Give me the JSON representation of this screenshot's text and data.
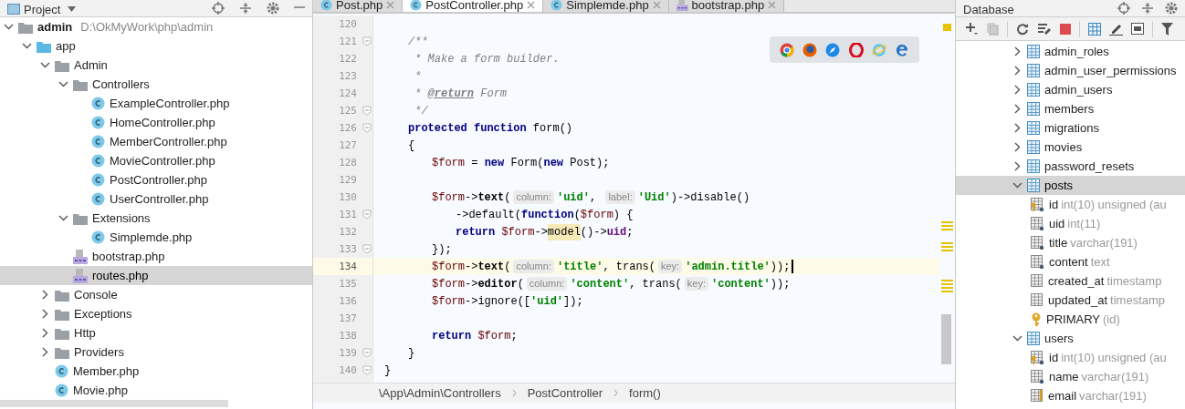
{
  "project_panel": {
    "title": "Project",
    "tree": [
      {
        "name": "admin",
        "path": "D:\\OkMyWork\\php\\admin",
        "kind": "folder",
        "expanded": true,
        "selected": false,
        "children": [
          {
            "name": "app",
            "kind": "source_folder",
            "expanded": true,
            "selected": false,
            "children": [
              {
                "name": "Admin",
                "kind": "folder",
                "expanded": true,
                "selected": false,
                "children": [
                  {
                    "name": "Controllers",
                    "kind": "folder",
                    "expanded": true,
                    "selected": false,
                    "children": [
                      {
                        "name": "ExampleController.php",
                        "kind": "class",
                        "selected": false
                      },
                      {
                        "name": "HomeController.php",
                        "kind": "class",
                        "selected": false
                      },
                      {
                        "name": "MemberController.php",
                        "kind": "class",
                        "selected": false
                      },
                      {
                        "name": "MovieController.php",
                        "kind": "class",
                        "selected": false
                      },
                      {
                        "name": "PostController.php",
                        "kind": "class",
                        "selected": false
                      },
                      {
                        "name": "UserController.php",
                        "kind": "class",
                        "selected": false
                      }
                    ]
                  },
                  {
                    "name": "Extensions",
                    "kind": "folder",
                    "expanded": true,
                    "selected": false,
                    "children": [
                      {
                        "name": "Simplemde.php",
                        "kind": "class",
                        "selected": false
                      }
                    ]
                  },
                  {
                    "name": "bootstrap.php",
                    "kind": "php",
                    "selected": false
                  },
                  {
                    "name": "routes.php",
                    "kind": "php",
                    "selected": true
                  }
                ]
              },
              {
                "name": "Console",
                "kind": "folder",
                "expanded": false,
                "selected": false
              },
              {
                "name": "Exceptions",
                "kind": "folder",
                "expanded": false,
                "selected": false
              },
              {
                "name": "Http",
                "kind": "folder",
                "expanded": false,
                "selected": false
              },
              {
                "name": "Providers",
                "kind": "folder",
                "expanded": false,
                "selected": false
              },
              {
                "name": "Member.php",
                "kind": "class",
                "selected": false
              },
              {
                "name": "Movie.php",
                "kind": "class",
                "selected": false
              }
            ]
          }
        ]
      }
    ]
  },
  "editor": {
    "tabs": [
      {
        "label": "Post.php",
        "kind": "class",
        "selected": false
      },
      {
        "label": "PostController.php",
        "kind": "class",
        "selected": true
      },
      {
        "label": "Simplemde.php",
        "kind": "class",
        "selected": false
      },
      {
        "label": "bootstrap.php",
        "kind": "php",
        "selected": false
      }
    ],
    "lines": [
      {
        "number": "120",
        "fold": false,
        "current": false,
        "children": [
          {
            "number": "121",
            "fold": true,
            "current": false,
            "tokens": [
              {
                "kind": "comment",
                "text": "/**"
              }
            ]
          },
          {
            "number": "122",
            "fold": false,
            "current": false,
            "tokens": [
              {
                "kind": "comment",
                "text": " * Make a form builder."
              }
            ]
          },
          {
            "number": "123",
            "fold": false,
            "current": false,
            "tokens": [
              {
                "kind": "comment",
                "text": " *"
              }
            ]
          },
          {
            "number": "124",
            "fold": false,
            "current": false,
            "tokens": [
              {
                "kind": "comment",
                "text": " * "
              },
              {
                "kind": "doc_tag",
                "text": "@return"
              },
              {
                "kind": "comment",
                "text": " Form"
              }
            ]
          },
          {
            "number": "125",
            "fold": true,
            "current": false,
            "tokens": [
              {
                "kind": "comment",
                "text": " */"
              }
            ]
          },
          {
            "number": "126",
            "fold": true,
            "current": false,
            "tokens": [
              {
                "kind": "keyword",
                "text": "protected function"
              },
              {
                "kind": "plain",
                "text": " form()"
              }
            ]
          },
          {
            "number": "127",
            "fold": false,
            "current": false,
            "tokens": [
              {
                "kind": "plain",
                "text": "{"
              }
            ],
            "children": [
              {
                "number": "128",
                "fold": false,
                "current": false,
                "tokens": [
                  {
                    "kind": "variable",
                    "text": "$form"
                  },
                  {
                    "kind": "plain",
                    "text": " = "
                  },
                  {
                    "kind": "keyword",
                    "text": "new"
                  },
                  {
                    "kind": "plain",
                    "text": " Form("
                  },
                  {
                    "kind": "keyword",
                    "text": "new"
                  },
                  {
                    "kind": "plain",
                    "text": " Post);"
                  }
                ]
              },
              {
                "number": "129",
                "fold": false,
                "current": false
              },
              {
                "number": "130",
                "fold": false,
                "current": false,
                "tokens": [
                  {
                    "kind": "variable",
                    "text": "$form"
                  },
                  {
                    "kind": "plain",
                    "text": "->"
                  },
                  {
                    "kind": "method",
                    "text": "text"
                  },
                  {
                    "kind": "plain",
                    "text": "("
                  },
                  {
                    "kind": "hint",
                    "text": "column:"
                  },
                  {
                    "kind": "string",
                    "text": "'uid'"
                  },
                  {
                    "kind": "plain",
                    "text": ", "
                  },
                  {
                    "kind": "hint",
                    "text": "label:"
                  },
                  {
                    "kind": "string",
                    "text": "'Uid'"
                  },
                  {
                    "kind": "plain",
                    "text": ")->disable()"
                  }
                ],
                "children": [
                  {
                    "number": "131",
                    "fold": true,
                    "current": false,
                    "tokens": [
                      {
                        "kind": "plain",
                        "text": "->default("
                      },
                      {
                        "kind": "keyword",
                        "text": "function"
                      },
                      {
                        "kind": "plain",
                        "text": "("
                      },
                      {
                        "kind": "variable",
                        "text": "$form"
                      },
                      {
                        "kind": "plain",
                        "text": ") {"
                      }
                    ]
                  },
                  {
                    "number": "132",
                    "fold": false,
                    "current": false,
                    "tokens": [
                      {
                        "kind": "keyword",
                        "text": "return "
                      },
                      {
                        "kind": "variable",
                        "text": "$form"
                      },
                      {
                        "kind": "plain",
                        "text": "->"
                      },
                      {
                        "kind": "highlighted",
                        "text": "model"
                      },
                      {
                        "kind": "plain",
                        "text": "()->"
                      },
                      {
                        "kind": "field",
                        "text": "uid"
                      },
                      {
                        "kind": "plain",
                        "text": ";"
                      }
                    ]
                  }
                ]
              },
              {
                "number": "133",
                "fold": true,
                "current": false,
                "tokens": [
                  {
                    "kind": "plain",
                    "text": "});"
                  }
                ]
              },
              {
                "number": "134",
                "fold": false,
                "current": true,
                "tokens": [
                  {
                    "kind": "variable",
                    "text": "$form"
                  },
                  {
                    "kind": "plain",
                    "text": "->"
                  },
                  {
                    "kind": "method",
                    "text": "text"
                  },
                  {
                    "kind": "plain",
                    "text": "("
                  },
                  {
                    "kind": "hint",
                    "text": "column:"
                  },
                  {
                    "kind": "string",
                    "text": "'title'"
                  },
                  {
                    "kind": "plain",
                    "text": ", trans("
                  },
                  {
                    "kind": "hint",
                    "text": "key:"
                  },
                  {
                    "kind": "string",
                    "text": "'admin.title'"
                  },
                  {
                    "kind": "plain",
                    "text": "));"
                  }
                ]
              },
              {
                "number": "135",
                "fold": false,
                "current": false,
                "tokens": [
                  {
                    "kind": "variable",
                    "text": "$form"
                  },
                  {
                    "kind": "plain",
                    "text": "->"
                  },
                  {
                    "kind": "method",
                    "text": "editor"
                  },
                  {
                    "kind": "plain",
                    "text": "("
                  },
                  {
                    "kind": "hint",
                    "text": "column:"
                  },
                  {
                    "kind": "string",
                    "text": "'content'"
                  },
                  {
                    "kind": "plain",
                    "text": ", trans("
                  },
                  {
                    "kind": "hint",
                    "text": "key:"
                  },
                  {
                    "kind": "string",
                    "text": "'content'"
                  },
                  {
                    "kind": "plain",
                    "text": "));"
                  }
                ]
              },
              {
                "number": "136",
                "fold": false,
                "current": false,
                "tokens": [
                  {
                    "kind": "variable",
                    "text": "$form"
                  },
                  {
                    "kind": "plain",
                    "text": "->ignore(["
                  },
                  {
                    "kind": "string",
                    "text": "'uid'"
                  },
                  {
                    "kind": "plain",
                    "text": "]);"
                  }
                ]
              },
              {
                "number": "137",
                "fold": false,
                "current": false
              },
              {
                "number": "138",
                "fold": false,
                "current": false,
                "tokens": [
                  {
                    "kind": "keyword",
                    "text": "return "
                  },
                  {
                    "kind": "variable",
                    "text": "$form"
                  },
                  {
                    "kind": "plain",
                    "text": ";"
                  }
                ]
              }
            ]
          },
          {
            "number": "139",
            "fold": true,
            "current": false,
            "tokens": [
              {
                "kind": "plain",
                "text": "}"
              }
            ]
          }
        ]
      },
      {
        "number": "140",
        "fold": true,
        "current": false,
        "tokens": [
          {
            "kind": "plain",
            "text": "}"
          }
        ]
      }
    ],
    "breadcrumb": [
      "\\App\\Admin\\Controllers",
      "PostController",
      "form()"
    ]
  },
  "database_panel": {
    "title": "Database",
    "tree": [
      {
        "name": "admin_roles",
        "kind": "table",
        "expanded": false,
        "selected": false
      },
      {
        "name": "admin_user_permissions",
        "kind": "table",
        "expanded": false,
        "selected": false
      },
      {
        "name": "admin_users",
        "kind": "table",
        "expanded": false,
        "selected": false
      },
      {
        "name": "members",
        "kind": "table",
        "expanded": false,
        "selected": false
      },
      {
        "name": "migrations",
        "kind": "table",
        "expanded": false,
        "selected": false
      },
      {
        "name": "movies",
        "kind": "table",
        "expanded": false,
        "selected": false
      },
      {
        "name": "password_resets",
        "kind": "table",
        "expanded": false,
        "selected": false
      },
      {
        "name": "posts",
        "kind": "table",
        "expanded": true,
        "selected": true,
        "children": [
          {
            "name": "id",
            "type": "int(10) unsigned (au",
            "kind": "key_column",
            "selected": false
          },
          {
            "name": "uid",
            "type": "int(11)",
            "kind": "required_column",
            "selected": false
          },
          {
            "name": "title",
            "type": "varchar(191)",
            "kind": "required_column",
            "selected": false
          },
          {
            "name": "content",
            "type": "text",
            "kind": "required_column",
            "selected": false
          },
          {
            "name": "created_at",
            "type": "timestamp",
            "kind": "column",
            "selected": false
          },
          {
            "name": "updated_at",
            "type": "timestamp",
            "kind": "column",
            "selected": false
          },
          {
            "name": "PRIMARY",
            "type": "(id)",
            "kind": "primary_key",
            "selected": false
          }
        ]
      },
      {
        "name": "users",
        "kind": "table",
        "expanded": true,
        "selected": false,
        "children": [
          {
            "name": "id",
            "type": "int(10) unsigned (au",
            "kind": "key_column",
            "selected": false
          },
          {
            "name": "name",
            "type": "varchar(191)",
            "kind": "required_column",
            "selected": false
          },
          {
            "name": "email",
            "type": "varchar(191)",
            "kind": "indexed_column",
            "selected": false
          }
        ]
      }
    ]
  }
}
